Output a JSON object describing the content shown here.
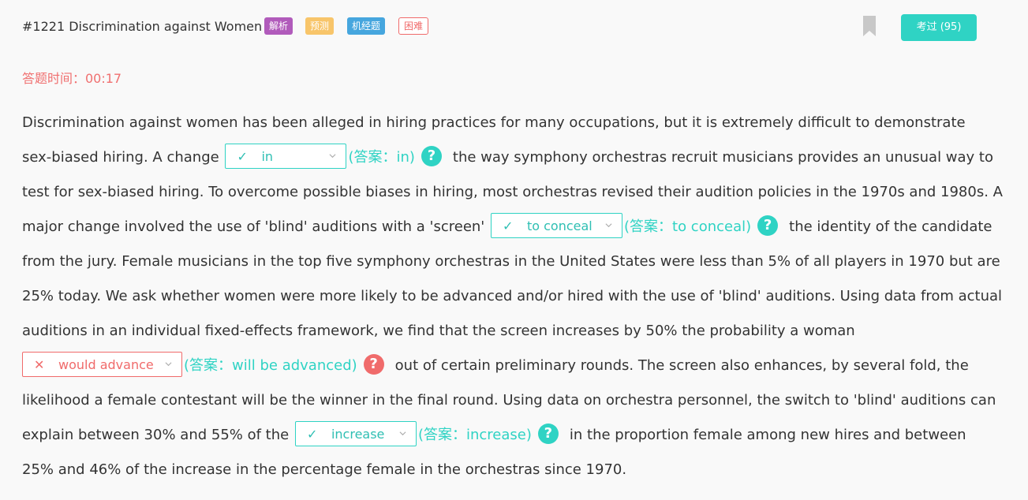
{
  "header": {
    "question_title": "#1221 Discrimination against Women",
    "tags": [
      "解析",
      "预测",
      "机经题",
      "困难"
    ],
    "pass_button": "考过 (95)"
  },
  "timer": "答题时间：00:17",
  "passage": {
    "l1": "Discrimination against women has been alleged in hiring practices for many occupations, but it is extremely difficult to demonstrate",
    "l2a": "sex-biased hiring. A change",
    "l2b": "the way symphony orchestras recruit musicians provides an unusual way to",
    "l3": "test for sex-biased hiring. To overcome possible biases in hiring, most orchestras revised their audition policies in the 1970s and 1980s. A",
    "l4a": "major change involved the use of 'blind' auditions with a 'screen'",
    "l4b": "the identity of the candidate",
    "l5": "from the jury. Female musicians in the top five symphony orchestras in the United States were less than 5% of all players in 1970 but are",
    "l6": "25% today. We ask whether women were more likely to be advanced and/or hired with the use of 'blind' auditions. Using data from actual",
    "l7": "auditions in an individual fixed-effects framework, we find that the screen increases by 50% the probability a woman",
    "l8b": "out of certain preliminary rounds. The screen also enhances, by several fold, the",
    "l9": "likelihood a female contestant will be the winner in the final round. Using data on orchestra personnel, the switch to 'blind' auditions can",
    "l10a": "explain between 30% and 55% of the",
    "l10b": "in the proportion female among new hires and between",
    "l11": "25% and 46% of the increase in the percentage female in the orchestras since 1970."
  },
  "blanks": [
    {
      "value": "in",
      "answer": "(答案：in)",
      "mark": "✓",
      "status": "correct"
    },
    {
      "value": "to conceal",
      "answer": "(答案：to conceal)",
      "mark": "✓",
      "status": "correct"
    },
    {
      "value": "would advance",
      "answer": "(答案：will be advanced)",
      "mark": "✕",
      "status": "wrong"
    },
    {
      "value": "increase",
      "answer": "(答案：increase)",
      "mark": "✓",
      "status": "correct"
    }
  ],
  "help_glyph": "?",
  "colors": {
    "accent": "#2fd3c4",
    "error": "#f06b6b",
    "tag_purple": "#b15bbb",
    "tag_yellow": "#f8c56a",
    "tag_blue": "#46a6de"
  },
  "icons": {
    "bookmark": "bookmark-icon",
    "chevron": "chevron-down-icon",
    "check": "check-icon",
    "cross": "cross-icon",
    "help": "question-circle-icon"
  }
}
